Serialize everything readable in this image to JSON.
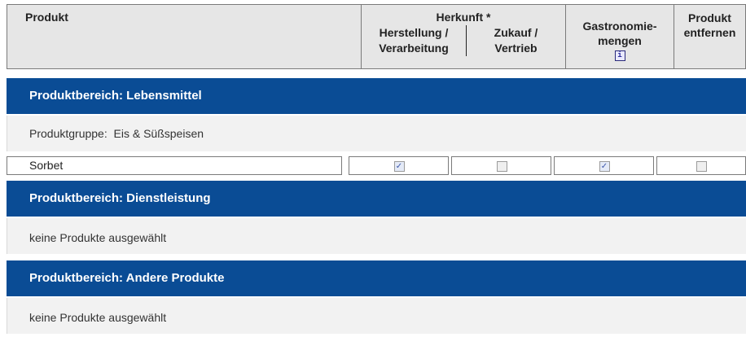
{
  "header": {
    "product": "Produkt",
    "origin": "Herkunft *",
    "origin_manufacture_line1": "Herstellung /",
    "origin_manufacture_line2": "Verarbeitung",
    "origin_purchase_line1": "Zukauf /",
    "origin_purchase_line2": "Vertrieb",
    "gastro_line1": "Gastronomie-",
    "gastro_line2": "mengen",
    "info_icon": "i",
    "remove_line1": "Produkt",
    "remove_line2": "entfernen"
  },
  "sections": [
    {
      "title": "Produktbereich: Lebensmittel",
      "group_label": "Produktgruppe:",
      "group_name": "Eis & Süßspeisen",
      "products": [
        {
          "name": "Sorbet",
          "manufacture": true,
          "purchase": false,
          "gastro": true,
          "remove": false
        }
      ]
    },
    {
      "title": "Produktbereich: Dienstleistung",
      "empty_text": "keine Produkte ausgewählt"
    },
    {
      "title": "Produktbereich: Andere Produkte",
      "empty_text": "keine Produkte ausgewählt"
    }
  ],
  "colors": {
    "band": "#0a4c95",
    "header_bg": "#e6e6e6",
    "row_bg": "#f2f2f2"
  }
}
